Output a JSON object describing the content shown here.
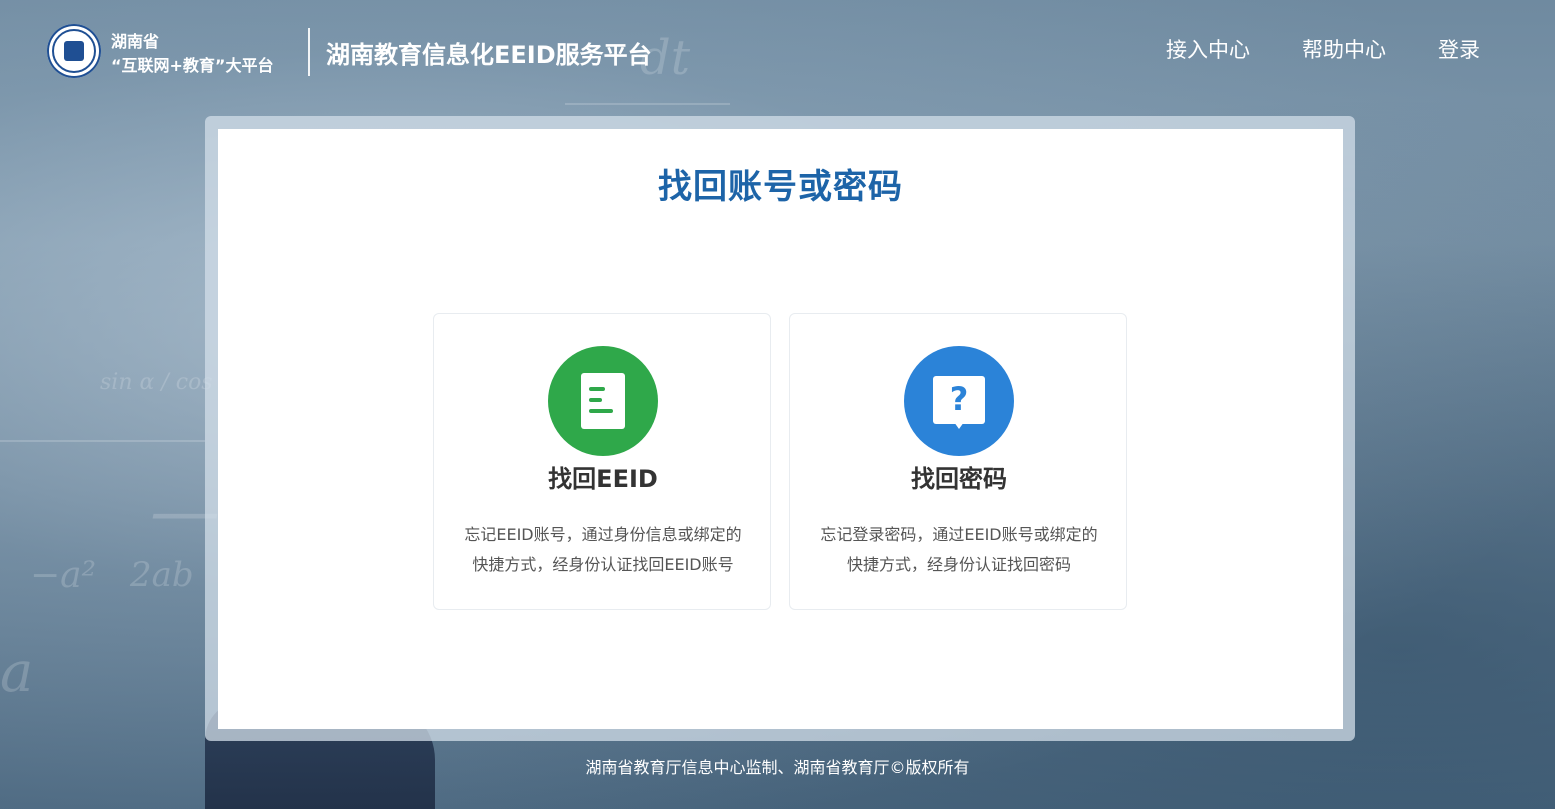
{
  "header": {
    "logo_icon": "hunan-education-seal",
    "brand_line1": "湖南省",
    "brand_line2": "“互联网+教育”大平台",
    "title": "湖南教育信息化EEID服务平台",
    "nav": {
      "access": "接入中心",
      "help": "帮助中心",
      "login": "登录"
    }
  },
  "main": {
    "title": "找回账号或密码",
    "cards": {
      "eeid": {
        "icon": "document-icon",
        "icon_color": "#2fa84a",
        "title": "找回EEID",
        "desc_line1": "忘记EEID账号，通过身份信息或绑定的",
        "desc_line2": "快捷方式，经身份认证找回EEID账号"
      },
      "password": {
        "icon": "question-bubble-icon",
        "icon_color": "#2b83d8",
        "question_mark": "?",
        "title": "找回密码",
        "desc_line1": "忘记登录密码，通过EEID账号或绑定的",
        "desc_line2": "快捷方式，经身份认证找回密码"
      }
    }
  },
  "footer": {
    "text": "湖南省教育厅信息中心监制、湖南省教育厅©版权所有"
  },
  "colors": {
    "title_blue": "#1d64a8",
    "eeid_green": "#2fa84a",
    "password_blue": "#2b83d8"
  }
}
